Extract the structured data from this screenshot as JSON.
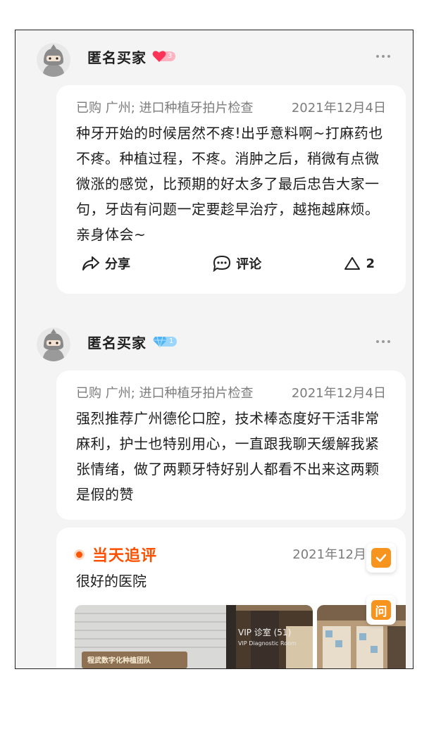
{
  "reviews": [
    {
      "username": "匿名买家",
      "badge_count": "3",
      "purchase_info": "已购 广州; 进口种植牙拍片检查",
      "date": "2021年12月4日",
      "content": "种牙开始的时候居然不疼!出乎意料啊~打麻药也不疼。种植过程，不疼。消肿之后，稍微有点微微涨的感觉，比预期的好太多了最后忠告大家一句，牙齿有问题一定要趁早治疗，越拖越麻烦。亲身体会~",
      "share_label": "分享",
      "comment_label": "评论",
      "like_count": "2"
    },
    {
      "username": "匿名买家",
      "badge_count": "1",
      "purchase_info": "已购 广州; 进口种植牙拍片检查",
      "date": "2021年12月4日",
      "content": "强烈推荐广州德伦口腔，技术棒态度好干活非常麻利，护士也特别用心，一直跟我聊天缓解我紧张情绪，做了两颗牙特好别人都看不出来这两颗是假的赞",
      "followup": {
        "label": "当天追评",
        "date": "2021年12月",
        "text": "很好的医院"
      },
      "photos": [
        {
          "sign": "程武数字化种植团队"
        },
        {
          "sign": "VIP 诊室 (51)",
          "sub": "VIP Diagnostic Room"
        },
        {
          "sign": ""
        }
      ]
    }
  ],
  "float_buttons": {
    "ask_label": "问"
  },
  "colors": {
    "accent": "#ff5000",
    "heart": "#ff3355",
    "diamond": "#4fb3f6",
    "float": "#f7941d"
  }
}
